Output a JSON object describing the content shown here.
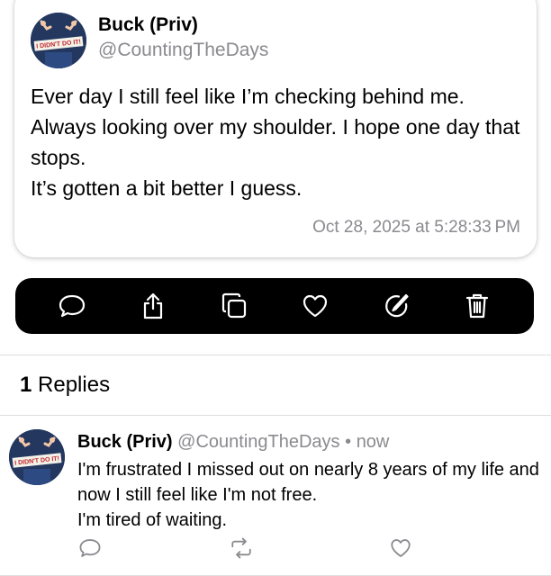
{
  "post": {
    "author": "Buck (Priv)",
    "handle": "@CountingTheDays",
    "avatar_text": "I DIDN'T DO IT!",
    "body_lines": [
      "Ever day I still feel like I’m checking behind me. Always looking over my shoulder. I hope one day that stops.",
      "It’s gotten a bit better I guess."
    ],
    "timestamp": "Oct 28, 2025 at 5:28:33 PM"
  },
  "actions": [
    {
      "icon": "reply-icon"
    },
    {
      "icon": "share-icon"
    },
    {
      "icon": "copy-icon"
    },
    {
      "icon": "heart-icon"
    },
    {
      "icon": "edit-icon"
    },
    {
      "icon": "trash-icon"
    }
  ],
  "replies": {
    "count": "1",
    "label": "Replies",
    "items": [
      {
        "author": "Buck (Priv)",
        "handle": "@CountingTheDays",
        "separator": "•",
        "time": "now",
        "avatar_text": "I DIDN'T DO IT!",
        "body_lines": [
          "I'm frustrated I missed out on nearly 8 years of my life and now I still feel like I'm not free.",
          "I'm tired of waiting."
        ],
        "actions": [
          {
            "icon": "reply-icon"
          },
          {
            "icon": "repost-icon"
          },
          {
            "icon": "heart-icon"
          }
        ]
      }
    ]
  },
  "colors": {
    "secondary_text": "#8a8a8f",
    "action_bar": "#000000",
    "avatar_bg": "#23375f"
  }
}
